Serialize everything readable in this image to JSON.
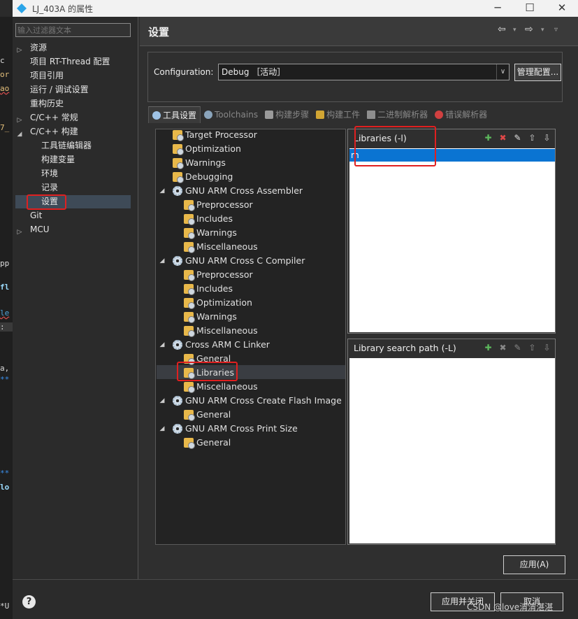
{
  "window": {
    "title": "LJ_403A 的属性",
    "minimize": "─",
    "maximize": "☐",
    "close": "✕"
  },
  "editor_fragments": [
    "c",
    "or",
    "ao",
    "7_",
    "pp",
    "fl",
    "le",
    ":",
    "a,",
    "**",
    "**",
    "lo",
    "*U"
  ],
  "nav": {
    "filter_placeholder": "输入过滤器文本",
    "items": [
      {
        "label": "资源",
        "arrow": "▷"
      },
      {
        "label": "项目 RT-Thread 配置"
      },
      {
        "label": "项目引用"
      },
      {
        "label": "运行 / 调试设置"
      },
      {
        "label": "重构历史"
      },
      {
        "label": "C/C++ 常规",
        "arrow": "▷"
      },
      {
        "label": "C/C++ 构建",
        "arrow": "◢"
      },
      {
        "label": "工具链编辑器"
      },
      {
        "label": "构建变量"
      },
      {
        "label": "环境"
      },
      {
        "label": "记录"
      },
      {
        "label": "设置",
        "selected": true
      },
      {
        "label": "Git"
      },
      {
        "label": "MCU",
        "arrow": "▷"
      }
    ]
  },
  "header": {
    "title": "设置",
    "back": "⇦",
    "back_menu": "▾",
    "forward": "⇨",
    "forward_menu": "▾",
    "view_menu": "▿"
  },
  "configuration": {
    "label": "Configuration:",
    "value": "Debug ［活动］",
    "manage_label": "管理配置..."
  },
  "tabs": [
    {
      "label": "工具设置",
      "active": true,
      "icon": "gear-icon",
      "color": "#9fc3e6"
    },
    {
      "label": "Toolchains",
      "icon": "gear-icon",
      "color": "#8aa4bb"
    },
    {
      "label": "构建步骤",
      "icon": "hammer-icon",
      "color": "#9a9a9a"
    },
    {
      "label": "构建工件",
      "icon": "trophy-icon",
      "color": "#d1a533"
    },
    {
      "label": "二进制解析器",
      "icon": "binary-icon",
      "color": "#8e8e8e"
    },
    {
      "label": "错误解析器",
      "icon": "error-icon",
      "color": "#d04040"
    }
  ],
  "tree": [
    {
      "label": "Target Processor",
      "icon": "folder"
    },
    {
      "label": "Optimization",
      "icon": "folder"
    },
    {
      "label": "Warnings",
      "icon": "folder"
    },
    {
      "label": "Debugging",
      "icon": "folder"
    },
    {
      "label": "GNU ARM Cross Assembler",
      "icon": "gear",
      "toggle": "◢"
    },
    {
      "label": "Preprocessor",
      "icon": "folder"
    },
    {
      "label": "Includes",
      "icon": "folder"
    },
    {
      "label": "Warnings",
      "icon": "folder"
    },
    {
      "label": "Miscellaneous",
      "icon": "folder"
    },
    {
      "label": "GNU ARM Cross C Compiler",
      "icon": "gear",
      "toggle": "◢"
    },
    {
      "label": "Preprocessor",
      "icon": "folder"
    },
    {
      "label": "Includes",
      "icon": "folder"
    },
    {
      "label": "Optimization",
      "icon": "folder"
    },
    {
      "label": "Warnings",
      "icon": "folder"
    },
    {
      "label": "Miscellaneous",
      "icon": "folder"
    },
    {
      "label": "Cross ARM C Linker",
      "icon": "gear",
      "toggle": "◢"
    },
    {
      "label": "General",
      "icon": "folder"
    },
    {
      "label": "Libraries",
      "icon": "folder",
      "selected": true
    },
    {
      "label": "Miscellaneous",
      "icon": "folder"
    },
    {
      "label": "GNU ARM Cross Create Flash Image",
      "icon": "gear",
      "toggle": "◢"
    },
    {
      "label": "General",
      "icon": "folder"
    },
    {
      "label": "GNU ARM Cross Print Size",
      "icon": "gear",
      "toggle": "◢"
    },
    {
      "label": "General",
      "icon": "folder"
    }
  ],
  "libraries": {
    "title": "Libraries (-l)",
    "items": [
      "m"
    ]
  },
  "library_search_path": {
    "title": "Library search path (-L)",
    "items": []
  },
  "list_tools": [
    "add-icon",
    "delete-icon",
    "edit-icon",
    "move-up-icon",
    "move-down-icon"
  ],
  "buttons": {
    "apply": "应用(A)",
    "apply_close": "应用并关闭",
    "cancel": "取消",
    "help": "?"
  },
  "watermark": "CSDN @love清清湛湛",
  "colors": {
    "highlight": "#e02020",
    "selection": "#0a74d2"
  }
}
